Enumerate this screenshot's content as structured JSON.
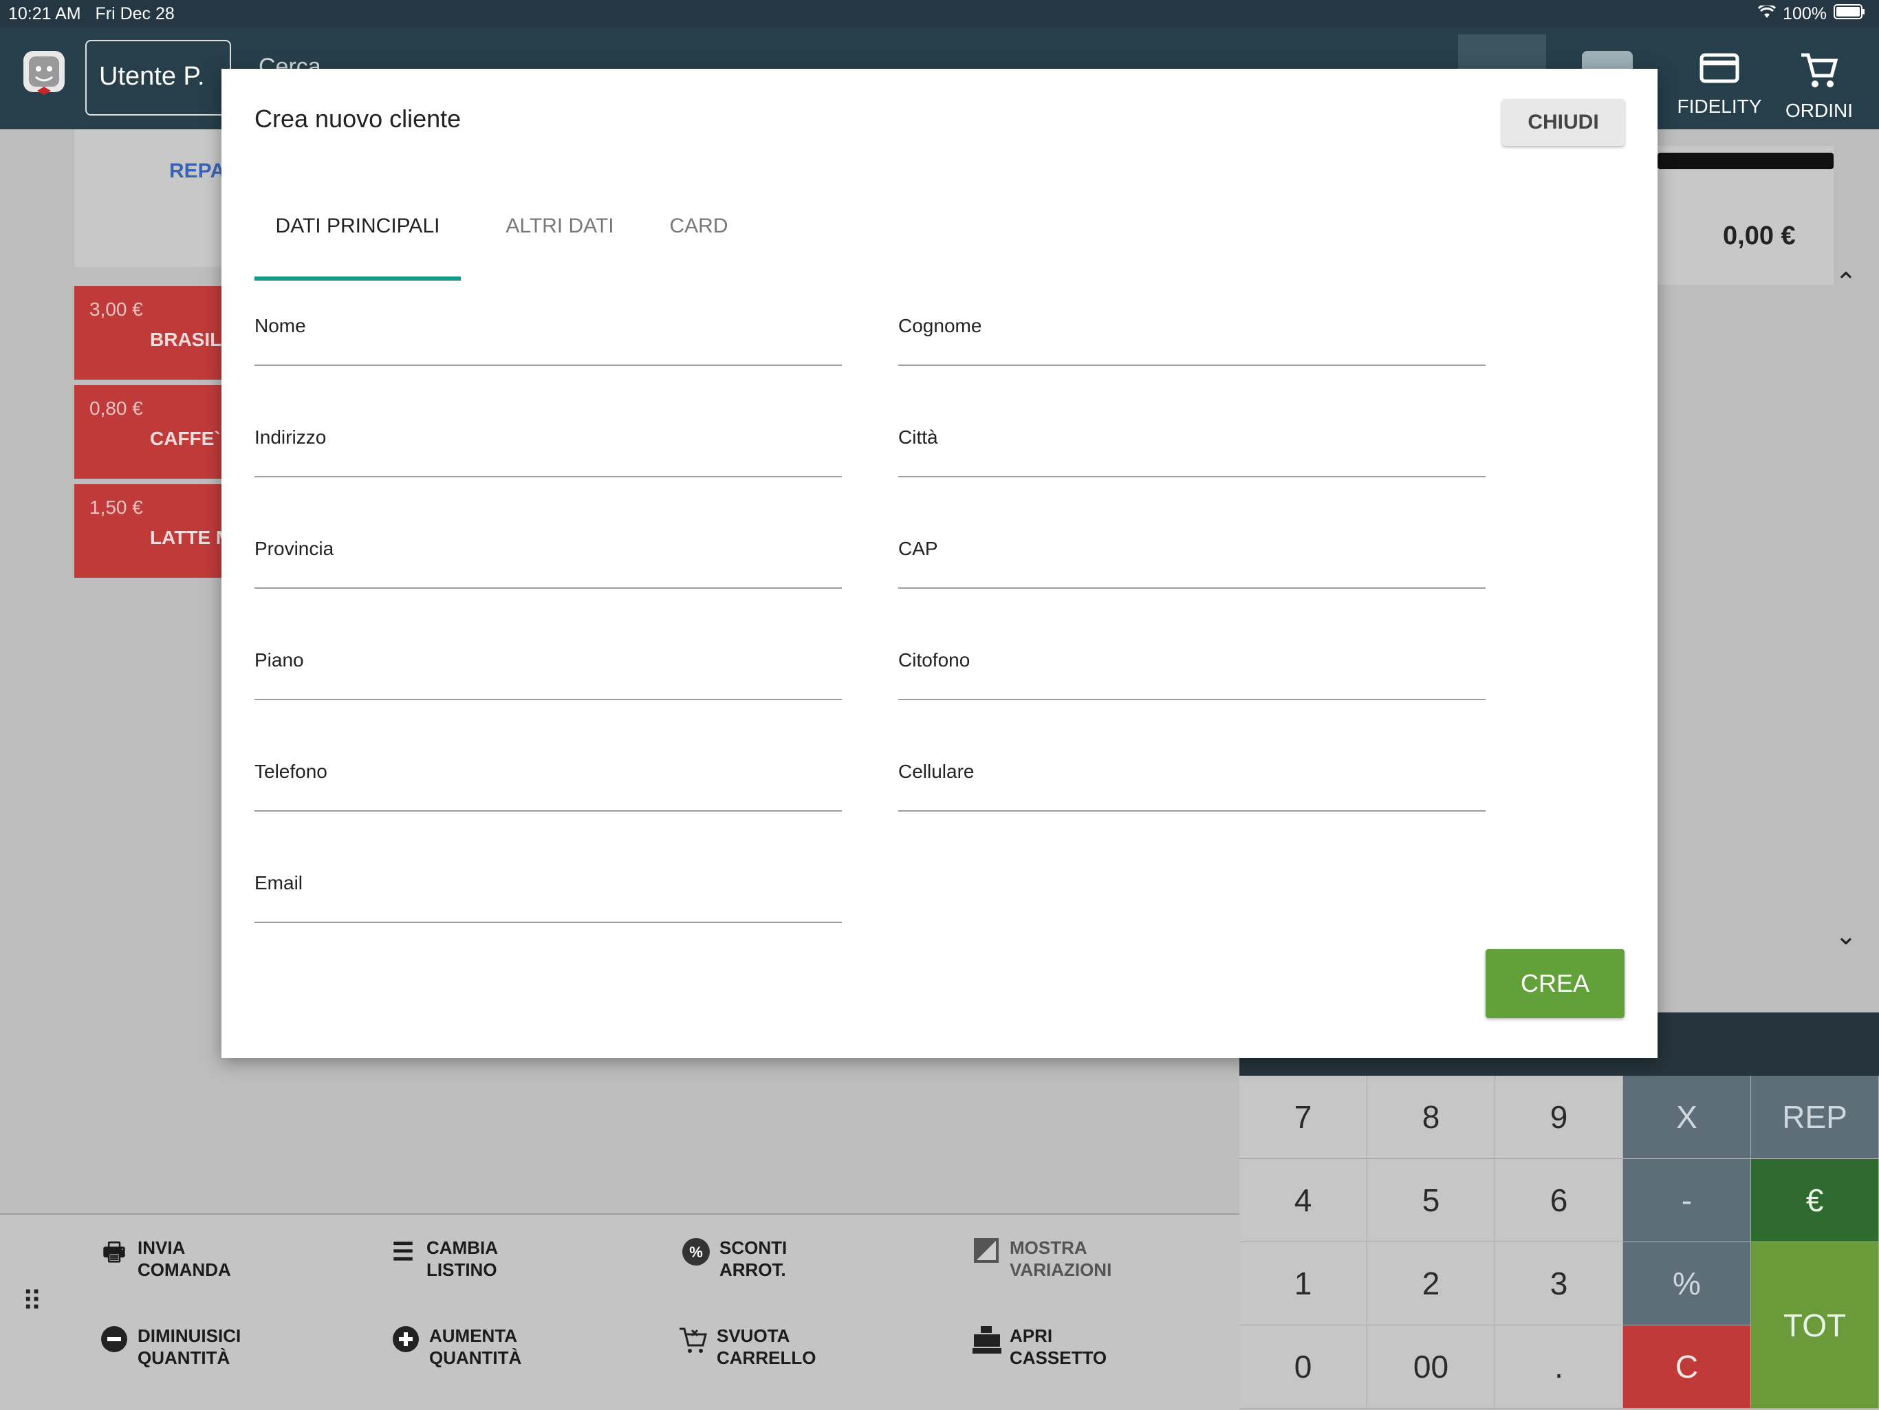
{
  "status_bar": {
    "time": "10:21 AM",
    "date": "Fri Dec 28",
    "battery": "100%"
  },
  "header": {
    "user_label": "Utente  P.",
    "search_hint": "Cerca",
    "fidelity_label": "FIDELITY",
    "ordini_label": "ORDINI"
  },
  "background": {
    "category_label": "REPA",
    "products": [
      {
        "price": "3,00 €",
        "name": "BRASIL"
      },
      {
        "price": "0,80 €",
        "name": "CAFFE` L"
      },
      {
        "price": "1,50 €",
        "name": "LATTE M"
      }
    ],
    "cart_total": "0,00 €"
  },
  "toolbar": [
    {
      "line1": "INVIA",
      "line2": "COMANDA",
      "icon": "printer-icon"
    },
    {
      "line1": "CAMBIA",
      "line2": "LISTINO",
      "icon": "list-icon"
    },
    {
      "line1": "SCONTI",
      "line2": "ARROT.",
      "icon": "discount-icon"
    },
    {
      "line1": "MOSTRA",
      "line2": "VARIAZIONI",
      "icon": "variations-icon"
    },
    {
      "line1": "DIMINUISICI",
      "line2": "QUANTITÀ",
      "icon": "minus-circle-icon"
    },
    {
      "line1": "AUMENTA",
      "line2": "QUANTITÀ",
      "icon": "plus-circle-icon"
    },
    {
      "line1": "SVUOTA",
      "line2": "CARRELLO",
      "icon": "empty-cart-icon"
    },
    {
      "line1": "APRI",
      "line2": "CASSETTO",
      "icon": "cash-register-icon"
    }
  ],
  "keypad": {
    "k7": "7",
    "k8": "8",
    "k9": "9",
    "kx": "X",
    "krep": "REP",
    "k4": "4",
    "k5": "5",
    "k6": "6",
    "kminus": "-",
    "keuro": "€",
    "k1": "1",
    "k2": "2",
    "k3": "3",
    "kpct": "%",
    "ktot": "TOT",
    "k0": "0",
    "k00": "00",
    "kdot": ".",
    "kc": "C"
  },
  "dialog": {
    "title": "Crea nuovo cliente",
    "close_label": "CHIUDI",
    "tabs": [
      "DATI PRINCIPALI",
      "ALTRI DATI",
      "CARD"
    ],
    "active_tab": "DATI PRINCIPALI",
    "fields": {
      "nome": "Nome",
      "cognome": "Cognome",
      "indirizzo": "Indirizzo",
      "citta": "Città",
      "provincia": "Provincia",
      "cap": "CAP",
      "piano": "Piano",
      "citofono": "Citofono",
      "telefono": "Telefono",
      "cellulare": "Cellulare",
      "email": "Email"
    },
    "submit_label": "CREA"
  },
  "colors": {
    "header_bg": "#263f4a",
    "accent_tab": "#17988a",
    "submit_green": "#62a03a",
    "product_red": "#c03a3a"
  }
}
